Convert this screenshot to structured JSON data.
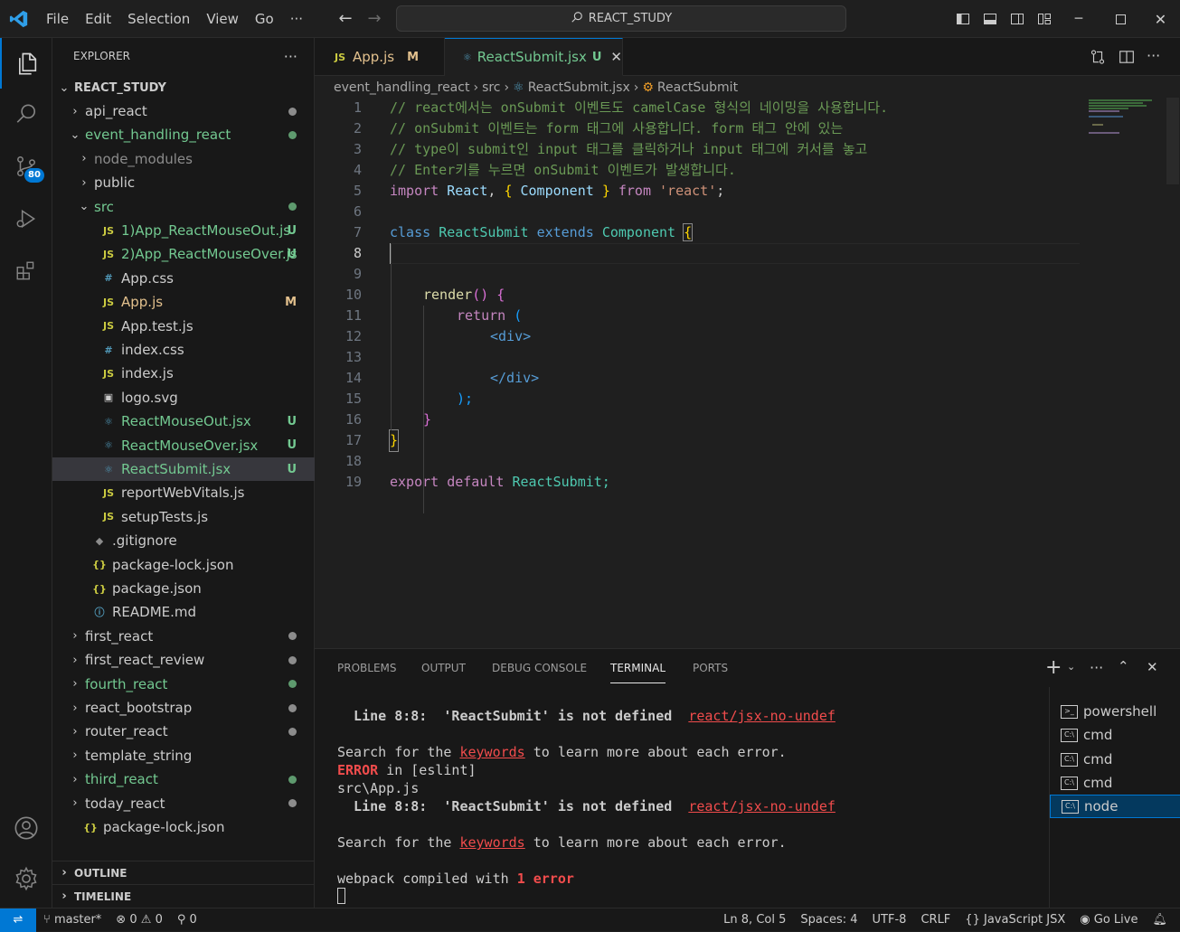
{
  "menu": {
    "file": "File",
    "edit": "Edit",
    "selection": "Selection",
    "view": "View",
    "go": "Go",
    "more": "···"
  },
  "search": {
    "label": "REACT_STUDY"
  },
  "activity": {
    "scm_badge": "80"
  },
  "explorer": {
    "title": "EXPLORER",
    "root": "REACT_STUDY",
    "items": [
      {
        "label": "api_react",
        "kind": "folder",
        "status": "dot-gray"
      },
      {
        "label": "event_handling_react",
        "kind": "folder-open",
        "status": "dot-green"
      },
      {
        "label": "node_modules",
        "kind": "folder",
        "status": ""
      },
      {
        "label": "public",
        "kind": "folder",
        "status": ""
      },
      {
        "label": "src",
        "kind": "folder-open",
        "status": "dot-green"
      },
      {
        "label": "1)App_ReactMouseOut.js",
        "kind": "js",
        "status": "U"
      },
      {
        "label": "2)App_ReactMouseOver.js",
        "kind": "js",
        "status": "U"
      },
      {
        "label": "App.css",
        "kind": "css",
        "status": ""
      },
      {
        "label": "App.js",
        "kind": "js",
        "status": "M"
      },
      {
        "label": "App.test.js",
        "kind": "test",
        "status": ""
      },
      {
        "label": "index.css",
        "kind": "css",
        "status": ""
      },
      {
        "label": "index.js",
        "kind": "js",
        "status": ""
      },
      {
        "label": "logo.svg",
        "kind": "svg",
        "status": ""
      },
      {
        "label": "ReactMouseOut.jsx",
        "kind": "jsx",
        "status": "U"
      },
      {
        "label": "ReactMouseOver.jsx",
        "kind": "jsx",
        "status": "U"
      },
      {
        "label": "ReactSubmit.jsx",
        "kind": "jsx",
        "status": "U"
      },
      {
        "label": "reportWebVitals.js",
        "kind": "js",
        "status": ""
      },
      {
        "label": "setupTests.js",
        "kind": "js",
        "status": ""
      },
      {
        "label": ".gitignore",
        "kind": "git",
        "status": ""
      },
      {
        "label": "package-lock.json",
        "kind": "json",
        "status": ""
      },
      {
        "label": "package.json",
        "kind": "json",
        "status": ""
      },
      {
        "label": "README.md",
        "kind": "md",
        "status": ""
      },
      {
        "label": "first_react",
        "kind": "folder",
        "status": "dot-gray"
      },
      {
        "label": "first_react_review",
        "kind": "folder",
        "status": "dot-gray"
      },
      {
        "label": "fourth_react",
        "kind": "folder",
        "status": "dot-green"
      },
      {
        "label": "react_bootstrap",
        "kind": "folder",
        "status": "dot-gray"
      },
      {
        "label": "router_react",
        "kind": "folder",
        "status": "dot-gray"
      },
      {
        "label": "template_string",
        "kind": "folder",
        "status": ""
      },
      {
        "label": "third_react",
        "kind": "folder",
        "status": "dot-green"
      },
      {
        "label": "today_react",
        "kind": "folder",
        "status": "dot-gray"
      },
      {
        "label": "package-lock.json",
        "kind": "json",
        "status": ""
      }
    ],
    "outline": "OUTLINE",
    "timeline": "TIMELINE"
  },
  "tabs": [
    {
      "label": "App.js",
      "status": "M",
      "icon": "JS"
    },
    {
      "label": "ReactSubmit.jsx",
      "status": "U"
    }
  ],
  "breadcrumb": {
    "a": "event_handling_react",
    "b": "src",
    "c": "ReactSubmit.jsx",
    "d": "ReactSubmit"
  },
  "code": {
    "l1": "// react에서는 onSubmit 이벤트도 camelCase 형식의 네이밍을 사용합니다.",
    "l2": "// onSubmit 이벤트는 form 태그에 사용합니다. form 태그 안에 있는",
    "l3": "// type이 submit인 input 태그를 클릭하거나 input 태그에 커서를 놓고",
    "l4": "// Enter키를 누르면 onSubmit 이벤트가 발생합니다.",
    "import": "import",
    "react_id": "React",
    "comma": ",",
    "lbrace": "{",
    "component": "Component",
    "rbrace": "}",
    "from": "from",
    "react_str": "'react'",
    "semi": ";",
    "class": "class",
    "classname": "ReactSubmit",
    "extends": "extends",
    "render": "render",
    "parens": "()",
    "return": "return",
    "lparen": "(",
    "div_open": "<div>",
    "div_close": "</div>",
    "rparen_semi": ");",
    "export": "export",
    "default": "default",
    "export_name": "ReactSubmit;"
  },
  "panel": {
    "tabs": [
      "PROBLEMS",
      "OUTPUT",
      "DEBUG CONSOLE",
      "TERMINAL",
      "PORTS"
    ],
    "terminal": {
      "t1_pre": "  Line 8:8:  'ReactSubmit' is not defined  ",
      "t1_rule": "react/jsx-no-undef",
      "t2_pre": "Search for the ",
      "t2_kw": "keywords",
      "t2_post": " to learn more about each error.",
      "t3_err": "ERROR",
      "t3_post": " in [eslint]",
      "t4": "src\\App.js",
      "t7_pre": "webpack compiled with ",
      "t7_err": "1 error"
    },
    "terminals": [
      "powershell",
      "cmd",
      "cmd",
      "cmd",
      "node"
    ]
  },
  "status": {
    "branch": "master*",
    "errors": "0",
    "warnings": "0",
    "ports": "0",
    "position": "Ln 8, Col 5",
    "spaces": "Spaces: 4",
    "encoding": "UTF-8",
    "eol": "CRLF",
    "language": "JavaScript JSX",
    "golive": "Go Live"
  }
}
